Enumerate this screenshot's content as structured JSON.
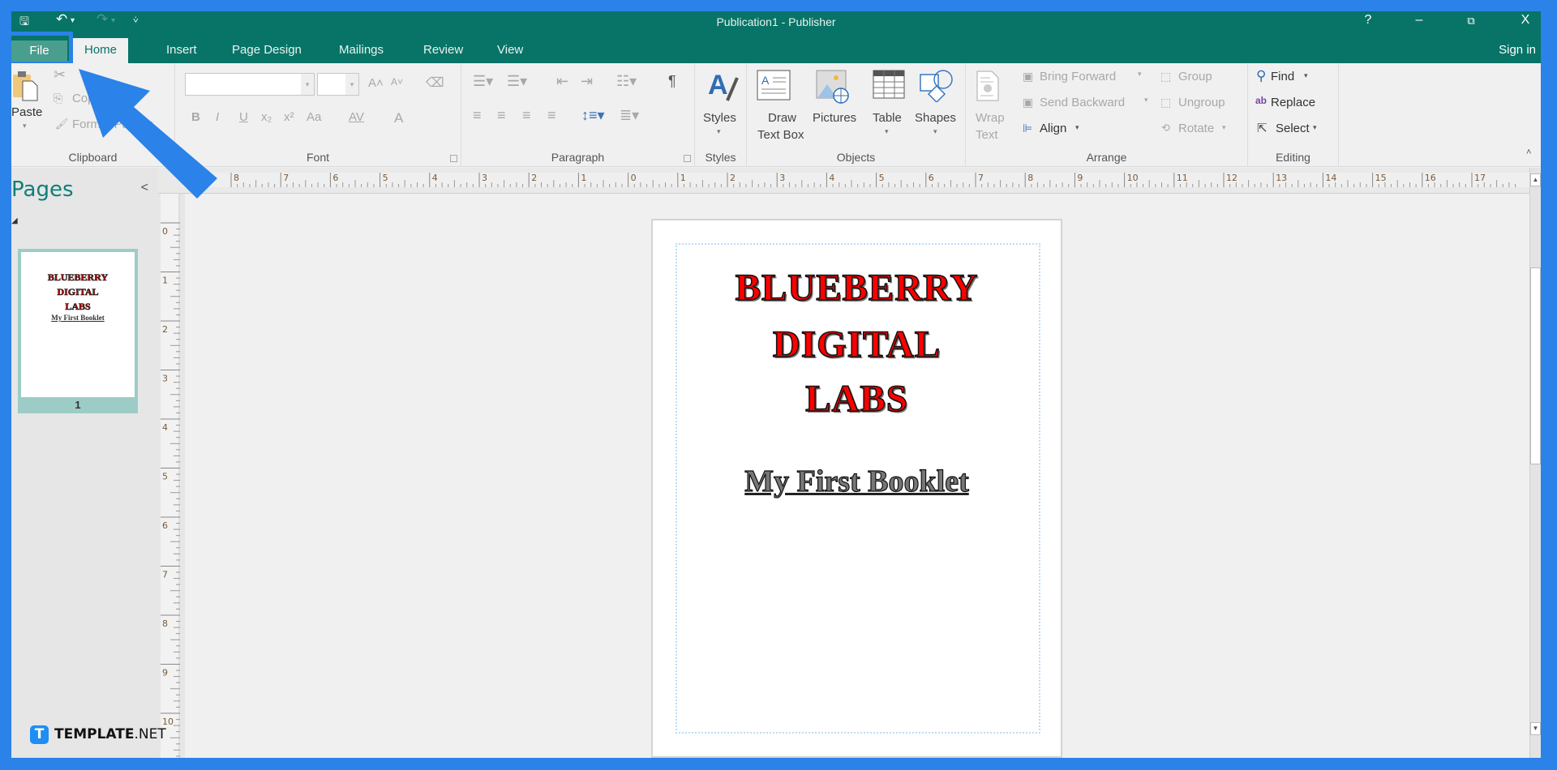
{
  "window": {
    "title": "Publication1 - Publisher",
    "controls": {
      "help": "?",
      "minimize": "–",
      "restore": "⧉",
      "close": "X"
    },
    "qat": {
      "save": "🖫",
      "undo": "↶",
      "undo_dd": "▾",
      "redo": "↷",
      "redo_dd": "▾",
      "customize": "⩒"
    }
  },
  "tabs": [
    {
      "label": "File"
    },
    {
      "label": "Home"
    },
    {
      "label": "Insert"
    },
    {
      "label": "Page Design"
    },
    {
      "label": "Mailings"
    },
    {
      "label": "Review"
    },
    {
      "label": "View"
    }
  ],
  "active_tab": "Home",
  "sign_in": "Sign in",
  "ribbon": {
    "clipboard": {
      "label": "Clipboard",
      "paste": "Paste",
      "cut": "Cut",
      "copy": "Copy",
      "format_painter": "Format Painter"
    },
    "font": {
      "label": "Font",
      "font_name": "",
      "font_size": "",
      "bold": "B",
      "italic": "I",
      "underline": "U",
      "subscript": "x₂",
      "superscript": "x²",
      "change_case": "Aa",
      "spacing": "AV",
      "font_color": "A",
      "grow": "A˄",
      "shrink": "A˅"
    },
    "paragraph": {
      "label": "Paragraph",
      "pilcrow": "¶"
    },
    "styles": {
      "label": "Styles",
      "button": "Styles"
    },
    "objects": {
      "label": "Objects",
      "draw_text_box_1": "Draw",
      "draw_text_box_2": "Text Box",
      "pictures": "Pictures",
      "table": "Table",
      "shapes": "Shapes"
    },
    "arrange": {
      "label": "Arrange",
      "wrap_text_1": "Wrap",
      "wrap_text_2": "Text",
      "bring_forward": "Bring Forward",
      "send_backward": "Send Backward",
      "align": "Align",
      "group": "Group",
      "ungroup": "Ungroup",
      "rotate": "Rotate"
    },
    "editing": {
      "label": "Editing",
      "find": "Find",
      "replace": "Replace",
      "select": "Select"
    }
  },
  "pages_panel": {
    "title": "Pages",
    "collapse": "<",
    "thumbnails": [
      {
        "number": "1"
      }
    ]
  },
  "rulers": {
    "horizontal": [
      "8",
      "7",
      "6",
      "5",
      "4",
      "3",
      "2",
      "1",
      "0",
      "1",
      "2",
      "3",
      "4",
      "5",
      "6",
      "7",
      "8",
      "9",
      "10",
      "11",
      "12",
      "13",
      "14",
      "15",
      "16",
      "17"
    ],
    "vertical": [
      "0",
      "1",
      "2",
      "3",
      "4",
      "5",
      "6",
      "7",
      "8",
      "9",
      "10"
    ]
  },
  "document": {
    "title_lines": [
      "BLUEBERRY",
      "DIGITAL",
      "LABS"
    ],
    "subtitle": "My First Booklet",
    "title_color": "#ff0000"
  },
  "watermark": {
    "brand": "TEMPLATE",
    "suffix": ".NET",
    "logo_letter": "T"
  },
  "colors": {
    "accent": "#077467",
    "frame": "#2b82e8",
    "pages_title": "#0f7f78"
  }
}
